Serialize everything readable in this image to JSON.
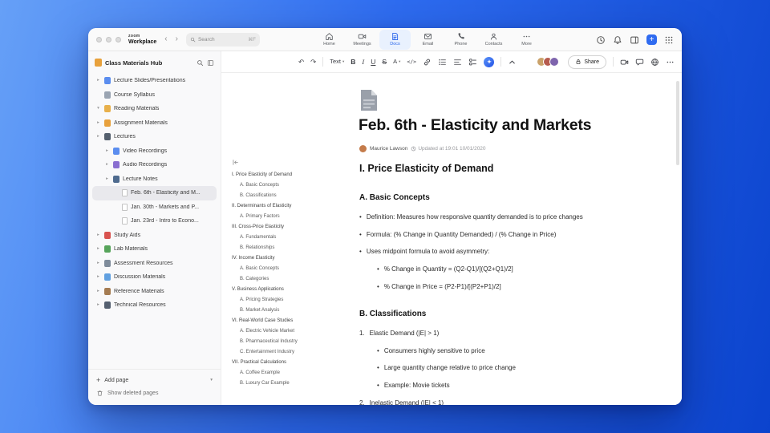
{
  "colors": {
    "accent": "#2563eb"
  },
  "icons": {
    "undo": "↶",
    "redo": "↷",
    "caret": "▾",
    "back": "‹",
    "forward": "›",
    "plus": "+"
  },
  "topbar": {
    "logo_top": "zoom",
    "logo_bottom": "Workplace",
    "search": {
      "placeholder": "Search",
      "shortcut": "⌘F"
    },
    "tabs": [
      {
        "label": "Home"
      },
      {
        "label": "Meetings"
      },
      {
        "label": "Docs",
        "active": true
      },
      {
        "label": "Email"
      },
      {
        "label": "Phone"
      },
      {
        "label": "Contacts"
      },
      {
        "label": "More"
      }
    ]
  },
  "sidebar": {
    "title": "Class Materials Hub",
    "header_icon": {
      "name": "notebook-icon",
      "color": "#e8a13c"
    },
    "tree": [
      {
        "level": 0,
        "chevron": "right",
        "icon": {
          "name": "presentation-icon",
          "color": "#5b8def",
          "kind": "swatch"
        },
        "label": "Lecture Slides/Presentations"
      },
      {
        "level": 0,
        "chevron": "none",
        "icon": {
          "name": "clipboard-icon",
          "color": "#9aa4b2",
          "kind": "swatch"
        },
        "label": "Course Syllabus"
      },
      {
        "level": 0,
        "chevron": "down",
        "icon": {
          "name": "book-icon",
          "color": "#e8b04b",
          "kind": "swatch"
        },
        "label": "Reading Materials"
      },
      {
        "level": 0,
        "chevron": "right",
        "icon": {
          "name": "folder-icon",
          "color": "#e8a13c",
          "kind": "swatch"
        },
        "label": "Assignment Materials"
      },
      {
        "level": 0,
        "chevron": "right",
        "icon": {
          "name": "graduation-cap-icon",
          "color": "#55606e",
          "kind": "swatch"
        },
        "label": "Lectures"
      },
      {
        "level": 1,
        "chevron": "right",
        "icon": {
          "name": "video-icon",
          "color": "#5b8def",
          "kind": "swatch"
        },
        "label": "Video Recordings"
      },
      {
        "level": 1,
        "chevron": "right",
        "icon": {
          "name": "headphones-icon",
          "color": "#8a6fd1",
          "kind": "swatch"
        },
        "label": "Audio Recordings"
      },
      {
        "level": 1,
        "chevron": "right",
        "icon": {
          "name": "notebook-icon",
          "color": "#4f6b8f",
          "kind": "swatch"
        },
        "label": "Lecture Notes"
      },
      {
        "level": 2,
        "chevron": "none",
        "icon": {
          "name": "page-icon",
          "color": "#ffffff",
          "kind": "page"
        },
        "label": "Feb. 6th - Elasticity and M...",
        "selected": true
      },
      {
        "level": 2,
        "chevron": "none",
        "icon": {
          "name": "page-icon",
          "color": "#ffffff",
          "kind": "page"
        },
        "label": "Jan. 30th - Markets and P..."
      },
      {
        "level": 2,
        "chevron": "none",
        "icon": {
          "name": "page-icon",
          "color": "#ffffff",
          "kind": "page"
        },
        "label": "Jan. 23rd - Intro to Econo..."
      },
      {
        "level": 0,
        "chevron": "right",
        "icon": {
          "name": "apple-icon",
          "color": "#d9534f",
          "kind": "swatch"
        },
        "label": "Study Aids"
      },
      {
        "level": 0,
        "chevron": "right",
        "icon": {
          "name": "pencil-icon",
          "color": "#57a45b",
          "kind": "swatch"
        },
        "label": "Lab Materials"
      },
      {
        "level": 0,
        "chevron": "right",
        "icon": {
          "name": "chart-icon",
          "color": "#7f8c9b",
          "kind": "swatch"
        },
        "label": "Assessment Resources"
      },
      {
        "level": 0,
        "chevron": "right",
        "icon": {
          "name": "chat-icon",
          "color": "#61a0e0",
          "kind": "swatch"
        },
        "label": "Discussion Materials"
      },
      {
        "level": 0,
        "chevron": "right",
        "icon": {
          "name": "books-icon",
          "color": "#a57c52",
          "kind": "swatch"
        },
        "label": "Reference Materials"
      },
      {
        "level": 0,
        "chevron": "right",
        "icon": {
          "name": "wrench-icon",
          "color": "#556070",
          "kind": "swatch"
        },
        "label": "Technical Resources"
      }
    ],
    "add_page": "Add page",
    "show_deleted": "Show deleted pages"
  },
  "toolbar": {
    "text_style": "Text",
    "bold": "B",
    "italic": "I",
    "underline": "U",
    "strike": "S",
    "color": "A",
    "code": "</>",
    "share_label": "Share",
    "avatars": [
      {
        "name": "participant-avatar",
        "color": "#caa26a"
      },
      {
        "name": "participant-avatar",
        "color": "#b65b4e"
      },
      {
        "name": "participant-avatar",
        "color": "#7e64ad"
      }
    ]
  },
  "doc": {
    "title": "Feb. 6th - Elasticity and Markets",
    "author": "Maurice Lawson",
    "author_avatar_color": "#c47b4a",
    "updated": "Updated at 19:01 10/01/2020",
    "outline": [
      {
        "level": 0,
        "label": "I. Price Elasticity of Demand"
      },
      {
        "level": 1,
        "label": "A. Basic Concepts"
      },
      {
        "level": 1,
        "label": "B. Classifications"
      },
      {
        "level": 0,
        "label": "II. Determinants of Elasticity"
      },
      {
        "level": 1,
        "label": "A. Primary Factors"
      },
      {
        "level": 0,
        "label": "III. Cross-Price Elasticity"
      },
      {
        "level": 1,
        "label": "A. Fundamentals"
      },
      {
        "level": 1,
        "label": "B. Relationships"
      },
      {
        "level": 0,
        "label": "IV. Income Elasticity"
      },
      {
        "level": 1,
        "label": "A. Basic Concepts"
      },
      {
        "level": 1,
        "label": "B. Categories"
      },
      {
        "level": 0,
        "label": "V. Business Applications"
      },
      {
        "level": 1,
        "label": "A. Pricing Strategies"
      },
      {
        "level": 1,
        "label": "B. Market Analysis"
      },
      {
        "level": 0,
        "label": "VI. Real-World Case Studies"
      },
      {
        "level": 1,
        "label": "A. Electric Vehicle Market"
      },
      {
        "level": 1,
        "label": "B. Pharmaceutical Industry"
      },
      {
        "level": 1,
        "label": "C. Entertainment Industry"
      },
      {
        "level": 0,
        "label": "VII. Practical Calculations"
      },
      {
        "level": 1,
        "label": "A. Coffee Example"
      },
      {
        "level": 1,
        "label": "B. Luxury Car Example"
      }
    ],
    "content": [
      {
        "type": "h2",
        "text": "I. Price Elasticity of Demand"
      },
      {
        "type": "h3",
        "text": "A. Basic Concepts"
      },
      {
        "type": "bullet",
        "level": 0,
        "text": "Definition: Measures how responsive quantity demanded is to price changes"
      },
      {
        "type": "bullet",
        "level": 0,
        "text": "Formula: (% Change in Quantity Demanded) / (% Change in Price)"
      },
      {
        "type": "bullet",
        "level": 0,
        "text": "Uses midpoint formula to avoid asymmetry:"
      },
      {
        "type": "bullet",
        "level": 1,
        "text": "% Change in Quantity = (Q2-Q1)/[(Q2+Q1)/2]"
      },
      {
        "type": "bullet",
        "level": 1,
        "text": "% Change in Price = (P2-P1)/[(P2+P1)/2]"
      },
      {
        "type": "h3",
        "text": "B. Classifications"
      },
      {
        "type": "ordered",
        "num": "1.",
        "level": 0,
        "text": "Elastic Demand (|E| > 1)"
      },
      {
        "type": "bullet",
        "level": 1,
        "text": "Consumers highly sensitive to price"
      },
      {
        "type": "bullet",
        "level": 1,
        "text": "Large quantity change relative to price change"
      },
      {
        "type": "bullet",
        "level": 1,
        "text": "Example: Movie tickets"
      },
      {
        "type": "ordered",
        "num": "2.",
        "level": 0,
        "text": "Inelastic Demand (|E| < 1)"
      }
    ]
  }
}
